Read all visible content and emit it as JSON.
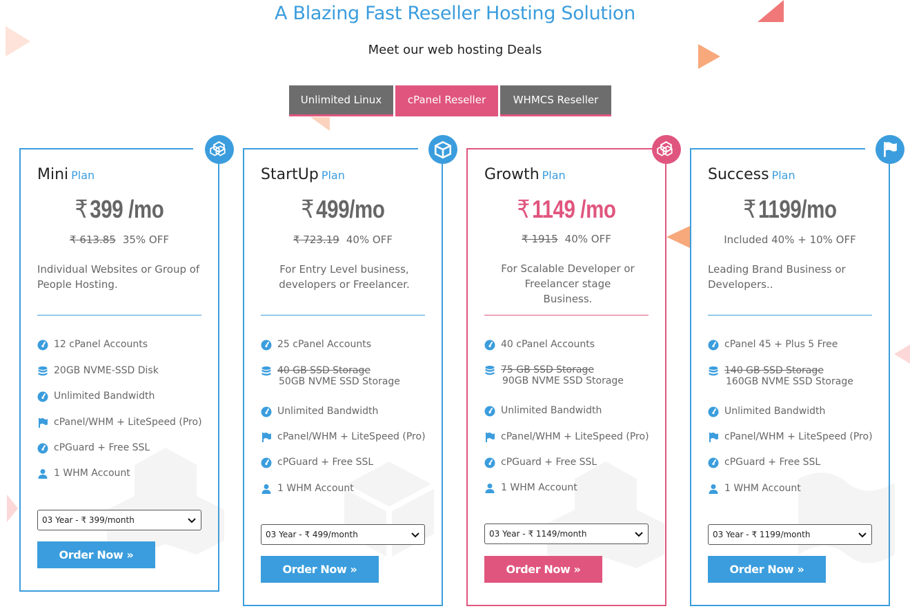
{
  "heading": "A Blazing Fast Reseller Hosting Solution",
  "subheading": "Meet our web hosting Deals",
  "tabs": [
    {
      "label": "Unlimited Linux",
      "active": false
    },
    {
      "label": "cPanel Reseller",
      "active": true
    },
    {
      "label": "WHMCS Reseller",
      "active": false
    }
  ],
  "colors": {
    "accent_blue": "#3b9ddd",
    "accent_pink": "#e0557e",
    "tab_grey": "#6d6d6d"
  },
  "plans": [
    {
      "name": "Mini",
      "plan_word": "Plan",
      "icon": "cubes-icon",
      "currency": "₹",
      "price": "399 /mo",
      "old_price": "₹ 613.85",
      "discount": "35% OFF",
      "description": "Individual Websites or Group of People Hosting.",
      "features": [
        {
          "icon": "gauge-icon",
          "text": "12 cPanel Accounts"
        },
        {
          "icon": "database-icon",
          "text": "20GB NVME-SSD Disk"
        },
        {
          "icon": "gauge-icon",
          "text": "Unlimited Bandwidth"
        },
        {
          "icon": "flag-icon",
          "text": "cPanel/WHM + LiteSpeed (Pro)"
        },
        {
          "icon": "gauge-icon",
          "text": "cPGuard + Free SSL"
        },
        {
          "icon": "user-icon",
          "text": "1 WHM Account"
        }
      ],
      "billing": "03 Year - ₹ 399/month",
      "order_label": "Order Now »"
    },
    {
      "name": "StartUp",
      "plan_word": "Plan",
      "icon": "cube-icon",
      "currency": "₹",
      "price": "499/mo",
      "old_price": "₹ 723.19",
      "discount": "40% OFF",
      "description": "For Entry Level business, developers or Freelancer.",
      "features": [
        {
          "icon": "gauge-icon",
          "text": "25 cPanel Accounts"
        },
        {
          "icon": "database-icon",
          "text": "40 GB SSD Storage",
          "sub": "50GB NVME SSD Storage"
        },
        {
          "icon": "gauge-icon",
          "text": "Unlimited Bandwidth"
        },
        {
          "icon": "flag-icon",
          "text": "cPanel/WHM + LiteSpeed (Pro)"
        },
        {
          "icon": "gauge-icon",
          "text": "cPGuard + Free SSL"
        },
        {
          "icon": "user-icon",
          "text": "1 WHM Account"
        }
      ],
      "billing": "03 Year - ₹ 499/month",
      "order_label": "Order Now »"
    },
    {
      "name": "Growth",
      "plan_word": "Plan",
      "icon": "cubes-icon",
      "currency": "₹",
      "price": "1149 /mo",
      "old_price": "₹ 1915",
      "discount": "40% OFF",
      "description": "For Scalable Developer or Freelancer stage Business.",
      "features": [
        {
          "icon": "gauge-icon",
          "text": "40 cPanel Accounts"
        },
        {
          "icon": "database-icon",
          "text": "75 GB SSD Storage",
          "sub": "90GB NVME SSD Storage"
        },
        {
          "icon": "gauge-icon",
          "text": "Unlimited Bandwidth"
        },
        {
          "icon": "flag-icon",
          "text": "cPanel/WHM + LiteSpeed (Pro)"
        },
        {
          "icon": "gauge-icon",
          "text": "cPGuard + Free SSL"
        },
        {
          "icon": "user-icon",
          "text": "1 WHM Account"
        }
      ],
      "billing": "03 Year - ₹ 1149/month",
      "order_label": "Order Now »"
    },
    {
      "name": "Success",
      "plan_word": "Plan",
      "icon": "flag-icon",
      "currency": "₹",
      "price": "1199/mo",
      "old_price": "",
      "discount": "Included 40% + 10% OFF",
      "description": "Leading Brand Business or Developers..",
      "features": [
        {
          "icon": "gauge-icon",
          "text": "cPanel 45 + Plus 5 Free"
        },
        {
          "icon": "database-icon",
          "text": "140 GB SSD Storage",
          "sub": "160GB NVME SSD Storage"
        },
        {
          "icon": "gauge-icon",
          "text": "Unlimited Bandwidth"
        },
        {
          "icon": "flag-icon",
          "text": "cPanel/WHM + LiteSpeed (Pro)"
        },
        {
          "icon": "gauge-icon",
          "text": "cPGuard + Free SSL"
        },
        {
          "icon": "user-icon",
          "text": "1 WHM Account"
        }
      ],
      "billing": "03 Year - ₹ 1199/month",
      "order_label": "Order Now »"
    }
  ]
}
